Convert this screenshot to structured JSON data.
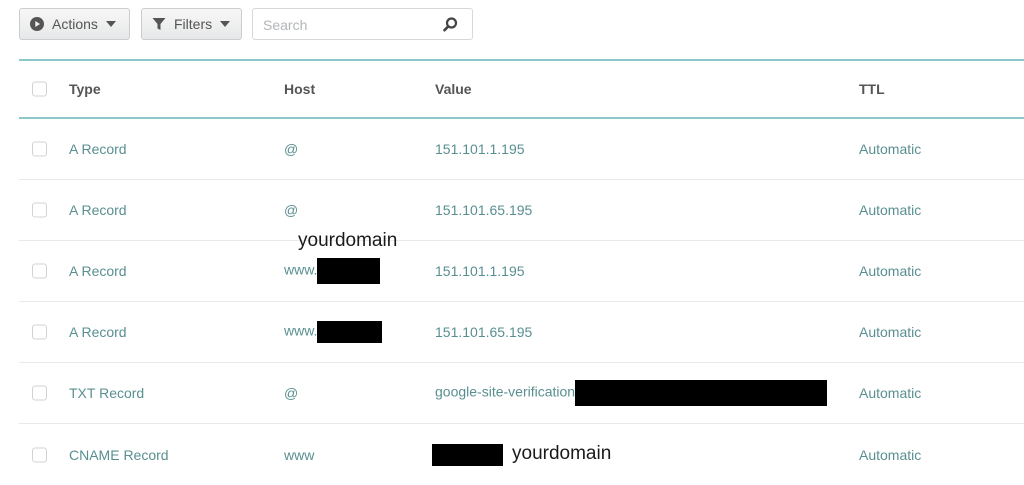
{
  "toolbar": {
    "actions_label": "Actions",
    "filters_label": "Filters",
    "search_placeholder": "Search"
  },
  "table": {
    "headers": {
      "type": "Type",
      "host": "Host",
      "value": "Value",
      "ttl": "TTL"
    },
    "rows": [
      {
        "type": "A Record",
        "host": "@",
        "value": "151.101.1.195",
        "ttl": "Automatic"
      },
      {
        "type": "A Record",
        "host": "@",
        "value": "151.101.65.195",
        "ttl": "Automatic"
      },
      {
        "type": "A Record",
        "host": "www.",
        "value": "151.101.1.195",
        "ttl": "Automatic"
      },
      {
        "type": "A Record",
        "host": "www.",
        "value": "151.101.65.195",
        "ttl": "Automatic"
      },
      {
        "type": "TXT Record",
        "host": "@",
        "value": "google-site-verification",
        "ttl": "Automatic"
      },
      {
        "type": "CNAME Record",
        "host": "www",
        "value": "",
        "ttl": "Automatic"
      }
    ]
  },
  "annotations": {
    "host_label": "yourdomain",
    "cname_label": "yourdomain"
  },
  "colors": {
    "accent": "#8cc7c9",
    "cell_text": "#5a8f91"
  }
}
